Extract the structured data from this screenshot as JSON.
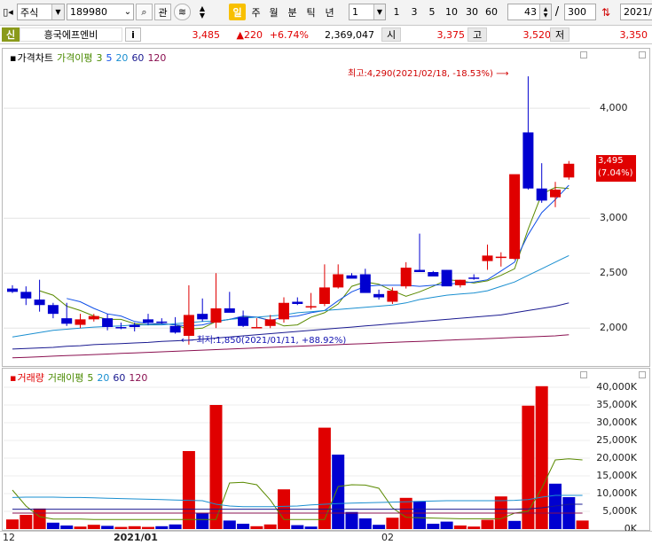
{
  "toolbar": {
    "market": "주식",
    "code": "189980",
    "kwan": "관",
    "period_daily": "일",
    "period_weekly": "주",
    "period_monthly": "월",
    "period_minute": "분",
    "period_tick": "틱",
    "period_year": "년",
    "interval_select": "1",
    "intervals": [
      "1",
      "3",
      "5",
      "10",
      "30",
      "60"
    ],
    "count_value": "43",
    "slash": "/",
    "count_total": "300",
    "date_value": "2021/"
  },
  "quote": {
    "badge": "신",
    "name": "흥국에프엔비",
    "info": "i",
    "price": "3,485",
    "change": "▲220",
    "change_pct": "+6.74%",
    "volume": "2,369,047",
    "open_label": "시",
    "open": "3,375",
    "high_label": "고",
    "high": "3,520",
    "low_label": "저",
    "low": "3,350"
  },
  "price_legend": {
    "title": "가격차트",
    "ma_label": "가격이평",
    "p1": "3",
    "p2": "5",
    "p3": "20",
    "p4": "60",
    "p5": "120"
  },
  "price_annotations": {
    "high": "최고:4,290(2021/02/18, -18.53%)",
    "low": "최저:1,850(2021/01/11, +88.92%)",
    "last_price": "3,495",
    "last_pct": "(7.04%)"
  },
  "volume_legend": {
    "title": "거래량",
    "ma_label": "거래이평",
    "p1": "5",
    "p2": "20",
    "p3": "60",
    "p4": "120"
  },
  "x_labels": {
    "a": "12",
    "b": "2021/01",
    "c": "02"
  },
  "colors": {
    "up": "#e00000",
    "down": "#0000d0",
    "ma3": "#5a8a00",
    "ma5": "#1050e8",
    "ma20": "#1a8fd0",
    "ma60": "#1a1a90",
    "ma120": "#8a1050"
  },
  "chart_data": [
    {
      "type": "candlestick",
      "title": "가격차트",
      "y_ticks": [
        2000,
        2500,
        3000,
        4000
      ],
      "y_tick_labels": [
        "2,000",
        "2,500",
        "3,000",
        "4,000"
      ],
      "ylim": [
        1680,
        4420
      ],
      "candles": [
        {
          "o": 2360,
          "h": 2390,
          "l": 2320,
          "c": 2330
        },
        {
          "o": 2330,
          "h": 2380,
          "l": 2210,
          "c": 2270
        },
        {
          "o": 2260,
          "h": 2440,
          "l": 2150,
          "c": 2210
        },
        {
          "o": 2210,
          "h": 2230,
          "l": 2090,
          "c": 2130
        },
        {
          "o": 2090,
          "h": 2230,
          "l": 2020,
          "c": 2040
        },
        {
          "o": 2030,
          "h": 2130,
          "l": 2000,
          "c": 2080
        },
        {
          "o": 2080,
          "h": 2130,
          "l": 2060,
          "c": 2110
        },
        {
          "o": 2090,
          "h": 2130,
          "l": 1980,
          "c": 2010
        },
        {
          "o": 2010,
          "h": 2050,
          "l": 1990,
          "c": 2000
        },
        {
          "o": 2030,
          "h": 2050,
          "l": 1970,
          "c": 2010
        },
        {
          "o": 2080,
          "h": 2130,
          "l": 2030,
          "c": 2050
        },
        {
          "o": 2060,
          "h": 2090,
          "l": 2040,
          "c": 2050
        },
        {
          "o": 2020,
          "h": 2100,
          "l": 1950,
          "c": 1960
        },
        {
          "o": 1930,
          "h": 2390,
          "l": 1850,
          "c": 2120
        },
        {
          "o": 2130,
          "h": 2270,
          "l": 2060,
          "c": 2080
        },
        {
          "o": 2050,
          "h": 2500,
          "l": 2000,
          "c": 2180
        },
        {
          "o": 2180,
          "h": 2330,
          "l": 2160,
          "c": 2140
        },
        {
          "o": 2100,
          "h": 2160,
          "l": 2010,
          "c": 2020
        },
        {
          "o": 2000,
          "h": 2090,
          "l": 2010,
          "c": 2010
        },
        {
          "o": 2020,
          "h": 2120,
          "l": 2000,
          "c": 2080
        },
        {
          "o": 2080,
          "h": 2280,
          "l": 2050,
          "c": 2230
        },
        {
          "o": 2240,
          "h": 2280,
          "l": 2210,
          "c": 2220
        },
        {
          "o": 2200,
          "h": 2320,
          "l": 2170,
          "c": 2200
        },
        {
          "o": 2220,
          "h": 2580,
          "l": 2200,
          "c": 2370
        },
        {
          "o": 2370,
          "h": 2580,
          "l": 2360,
          "c": 2490
        },
        {
          "o": 2480,
          "h": 2500,
          "l": 2460,
          "c": 2450
        },
        {
          "o": 2490,
          "h": 2540,
          "l": 2470,
          "c": 2320
        },
        {
          "o": 2310,
          "h": 2350,
          "l": 2260,
          "c": 2280
        },
        {
          "o": 2240,
          "h": 2370,
          "l": 2220,
          "c": 2340
        },
        {
          "o": 2380,
          "h": 2600,
          "l": 2360,
          "c": 2550
        },
        {
          "o": 2530,
          "h": 2860,
          "l": 2510,
          "c": 2510
        },
        {
          "o": 2510,
          "h": 2520,
          "l": 2480,
          "c": 2470
        },
        {
          "o": 2530,
          "h": 2530,
          "l": 2460,
          "c": 2380
        },
        {
          "o": 2390,
          "h": 2440,
          "l": 2370,
          "c": 2440
        },
        {
          "o": 2460,
          "h": 2490,
          "l": 2440,
          "c": 2450
        },
        {
          "o": 2610,
          "h": 2760,
          "l": 2530,
          "c": 2660
        },
        {
          "o": 2640,
          "h": 2690,
          "l": 2560,
          "c": 2650
        },
        {
          "o": 2630,
          "h": 3360,
          "l": 2620,
          "c": 3400
        },
        {
          "o": 3780,
          "h": 4290,
          "l": 3260,
          "c": 3270
        },
        {
          "o": 3270,
          "h": 3500,
          "l": 3140,
          "c": 3160
        },
        {
          "o": 3190,
          "h": 3330,
          "l": 3100,
          "c": 3260
        },
        {
          "o": 3370,
          "h": 3520,
          "l": 3350,
          "c": 3495
        }
      ],
      "series": [
        {
          "name": "3",
          "values": [
            null,
            null,
            2340,
            2300,
            2200,
            2160,
            2110,
            2080,
            2080,
            2040,
            2030,
            2040,
            2030,
            1990,
            2000,
            2060,
            2080,
            2100,
            2100,
            2070,
            2020,
            2030,
            2100,
            2140,
            2220,
            2380,
            2420,
            2400,
            2340,
            2290,
            2330,
            2380,
            2440,
            2430,
            2410,
            2430,
            2480,
            2540,
            2900,
            3220,
            3280,
            3270
          ]
        },
        {
          "name": "5",
          "values": [
            null,
            null,
            null,
            null,
            2270,
            2240,
            2180,
            2130,
            2110,
            2060,
            2040,
            2040,
            2030,
            2020,
            2030,
            2060,
            2080,
            2110,
            2100,
            2070,
            2100,
            2110,
            2140,
            2160,
            2250,
            2330,
            2380,
            2390,
            2390,
            2390,
            2380,
            2390,
            2400,
            2410,
            2420,
            2440,
            2520,
            2600,
            2850,
            3050,
            3170,
            3300
          ]
        },
        {
          "name": "20",
          "values": [
            1920,
            1940,
            1960,
            1980,
            1990,
            2000,
            2010,
            2015,
            2020,
            2030,
            2030,
            2030,
            2040,
            2050,
            2060,
            2065,
            2080,
            2090,
            2100,
            2110,
            2120,
            2140,
            2150,
            2160,
            2170,
            2180,
            2190,
            2200,
            2210,
            2230,
            2260,
            2280,
            2300,
            2310,
            2320,
            2340,
            2380,
            2420,
            2480,
            2540,
            2600,
            2660
          ]
        },
        {
          "name": "60",
          "values": [
            1810,
            1815,
            1820,
            1825,
            1835,
            1840,
            1850,
            1855,
            1860,
            1865,
            1870,
            1880,
            1885,
            1890,
            1900,
            1910,
            1920,
            1930,
            1940,
            1950,
            1960,
            1970,
            1980,
            1990,
            2000,
            2010,
            2020,
            2030,
            2040,
            2050,
            2060,
            2070,
            2080,
            2090,
            2100,
            2110,
            2120,
            2140,
            2160,
            2180,
            2200,
            2230
          ]
        },
        {
          "name": "120",
          "values": [
            1730,
            1735,
            1740,
            1745,
            1750,
            1755,
            1760,
            1765,
            1770,
            1775,
            1780,
            1785,
            1790,
            1795,
            1800,
            1805,
            1810,
            1815,
            1820,
            1825,
            1830,
            1835,
            1840,
            1845,
            1850,
            1855,
            1860,
            1865,
            1870,
            1875,
            1880,
            1885,
            1890,
            1895,
            1900,
            1905,
            1910,
            1915,
            1920,
            1925,
            1930,
            1940
          ]
        }
      ]
    },
    {
      "type": "bar",
      "title": "거래량",
      "y_ticks": [
        0,
        5000,
        10000,
        15000,
        20000,
        25000,
        30000,
        35000,
        40000
      ],
      "y_tick_labels": [
        "0K",
        "5,000K",
        "10,000K",
        "15,000K",
        "20,000K",
        "25,000K",
        "30,000K",
        "35,000K",
        "40,000K"
      ],
      "ylim": [
        0,
        41000
      ],
      "values": [
        2700,
        4000,
        5800,
        1800,
        1000,
        700,
        1200,
        900,
        600,
        800,
        600,
        800,
        1300,
        22000,
        4600,
        35000,
        2400,
        1500,
        800,
        1300,
        11200,
        1100,
        700,
        28600,
        21000,
        4800,
        3000,
        1200,
        3200,
        8800,
        7900,
        1500,
        2100,
        1000,
        700,
        2600,
        9200,
        2300,
        34800,
        40300,
        12800,
        9000,
        2400
      ],
      "up": [
        true,
        true,
        true,
        false,
        false,
        true,
        true,
        false,
        true,
        true,
        true,
        false,
        false,
        true,
        false,
        true,
        false,
        false,
        true,
        true,
        true,
        false,
        false,
        true,
        false,
        false,
        false,
        false,
        true,
        true,
        false,
        false,
        false,
        true,
        true,
        true,
        true,
        false,
        true,
        true,
        false,
        false,
        true
      ],
      "series": [
        {
          "name": "5",
          "values": [
            11000,
            6500,
            3500,
            2800,
            2800,
            2800,
            2700,
            2700,
            2700,
            2700,
            2700,
            2700,
            2700,
            2700,
            2700,
            2700,
            13000,
            13200,
            12500,
            8200,
            2700,
            2700,
            2700,
            2700,
            12000,
            12500,
            12400,
            11500,
            6000,
            3300,
            3200,
            3100,
            3000,
            2900,
            2900,
            2900,
            2900,
            4500,
            5000,
            11500,
            19500,
            19800,
            19500
          ]
        },
        {
          "name": "20",
          "values": [
            8900,
            9000,
            9000,
            9000,
            8900,
            8900,
            8800,
            8700,
            8600,
            8500,
            8400,
            8300,
            8200,
            8100,
            8000,
            7000,
            6500,
            6300,
            6300,
            6300,
            6400,
            6500,
            6800,
            7000,
            7200,
            7300,
            7400,
            7500,
            7600,
            7700,
            7800,
            7900,
            8000,
            8000,
            8000,
            8000,
            8000,
            8100,
            8300,
            9000,
            9500,
            9500,
            9500
          ]
        },
        {
          "name": "60",
          "values": [
            5600,
            5600,
            5600,
            5600,
            5600,
            5600,
            5600,
            5600,
            5600,
            5600,
            5600,
            5600,
            5600,
            5600,
            5600,
            5600,
            5600,
            5600,
            5600,
            5600,
            5600,
            5600,
            5600,
            5600,
            5600,
            5600,
            5600,
            5600,
            5600,
            5600,
            5600,
            5600,
            5600,
            5600,
            5600,
            5600,
            5600,
            5600,
            5700,
            6000,
            6500,
            7000,
            7000
          ]
        },
        {
          "name": "120",
          "values": [
            4500,
            4500,
            4500,
            4500,
            4500,
            4500,
            4500,
            4500,
            4500,
            4500,
            4500,
            4500,
            4500,
            4500,
            4500,
            4500,
            4500,
            4500,
            4500,
            4500,
            4500,
            4500,
            4500,
            4500,
            4500,
            4500,
            4500,
            4500,
            4500,
            4500,
            4500,
            4500,
            4500,
            4500,
            4500,
            4500,
            4500,
            4500,
            4500,
            4500,
            4500,
            4500,
            4500
          ]
        }
      ]
    }
  ]
}
